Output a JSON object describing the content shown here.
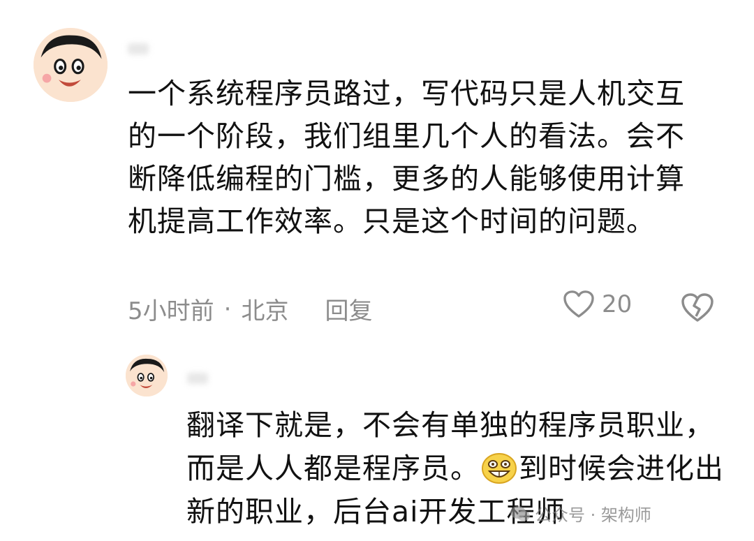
{
  "comment": {
    "text": "一个系统程序员路过，写代码只是人机交互的一个阶段，我们组里几个人的看法。会不断降低编程的门槛，更多的人能够使用计算机提高工作效率。只是这个时间的问题。",
    "time": "5小时前",
    "separator": "·",
    "location": "北京",
    "reply_label": "回复",
    "likes": "20"
  },
  "reply": {
    "text_before": "翻译下就是，不会有单独的程序员职业，而是人人都是程序员。",
    "text_after": "到时候会进化出新的职业，后台ai开发工程师"
  },
  "watermark": {
    "text": "公众号 · 架构师"
  },
  "icons": {
    "like": "heart-outline-icon",
    "dislike": "broken-heart-icon",
    "emoji": "grinning-face-emoji",
    "watermark": "wechat-icon"
  },
  "colors": {
    "text": "#111111",
    "meta": "#8c8c8c",
    "avatar_skin": "#fbe3cf"
  }
}
